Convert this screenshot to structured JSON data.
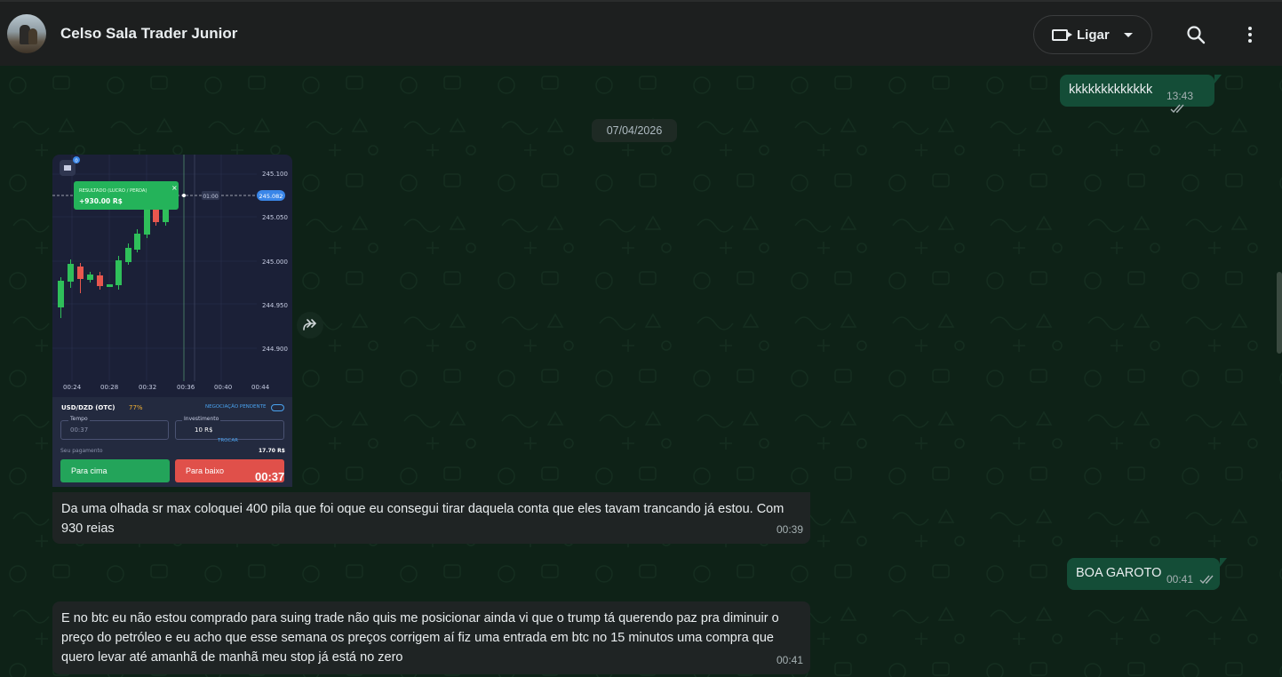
{
  "header": {
    "contact_name": "Celso Sala Trader Junior",
    "call_label": "Ligar"
  },
  "messages": {
    "m1": {
      "text": "kkkkkkkkkkkkk",
      "time": "13:43"
    },
    "date_divider": "07/04/2026",
    "m2": {
      "caption": "Da uma olhada sr max coloquei 400 pila que foi oque eu consegui tirar daquela conta que eles tavam trancando já estou. Com 930 reias",
      "time": "00:39"
    },
    "m3": {
      "text": "BOA GAROTO",
      "time": "00:41"
    },
    "m4": {
      "text": "E no btc eu não estou comprado para suing trade não quis me posicionar ainda vi que o trump tá querendo paz pra diminuir o preço do petróleo e eu acho que esse semana os preços corrigem aí fiz uma entrada em btc no 15 minutos uma compra que quero levar até amanhã de manhã meu stop já está no zero",
      "time": "00:41"
    }
  },
  "trade_image": {
    "badge_count": "0",
    "result_label": "RESULTADO (LUCRO / PERDA)",
    "result_value": "+930.00 R$",
    "price_levels": [
      "245.100",
      "245.050",
      "245.000",
      "244.950",
      "244.900"
    ],
    "current_price": "245.082",
    "timer_tag": "01:00",
    "time_ticks": [
      "00:24",
      "00:28",
      "00:32",
      "00:36",
      "00:40",
      "00:44"
    ],
    "pair": "USD/DZD (OTC)",
    "payout_pct": "77%",
    "pending_label": "NEGOCIAÇÃO PENDENTE",
    "time_label": "Tempo",
    "time_value": "00:37",
    "invest_label": "Investimento",
    "invest_value": "10 R$",
    "swap_label": "TROCAR",
    "payment_label": "Seu pagamento",
    "payment_value": "17.70 R$",
    "up_label": "Para cima",
    "down_label": "Para baixo",
    "countdown": "00:37"
  }
}
